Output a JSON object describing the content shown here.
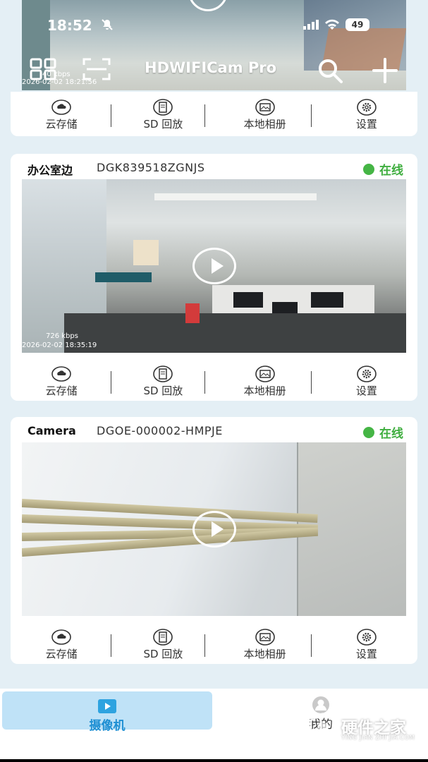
{
  "status_bar": {
    "time": "18:52",
    "battery": "49"
  },
  "header": {
    "title": "HDWIFICam Pro",
    "kbps": "40 kbps",
    "timestamp": "2026-02-02 18:21:56"
  },
  "top_card": {
    "actions": [
      {
        "label": "云存储",
        "icon": "cloud-icon"
      },
      {
        "label": "SD 回放",
        "icon": "sd-card-icon"
      },
      {
        "label": "本地相册",
        "icon": "photo-icon"
      },
      {
        "label": "设置",
        "icon": "gear-icon"
      }
    ]
  },
  "cameras": [
    {
      "name": "办公室边",
      "uid": "DGK839518ZGNJS",
      "status": "在线",
      "kbps": "726 kbps",
      "timestamp": "2026-02-02 18:35:19",
      "actions": [
        {
          "label": "云存储"
        },
        {
          "label": "SD 回放"
        },
        {
          "label": "本地相册"
        },
        {
          "label": "设置"
        }
      ]
    },
    {
      "name": "Camera",
      "uid": "DGOE-000002-HMPJE",
      "status": "在线",
      "actions": [
        {
          "label": "云存储"
        },
        {
          "label": "SD 回放"
        },
        {
          "label": "本地相册"
        },
        {
          "label": "设置"
        }
      ]
    }
  ],
  "bottom_nav": {
    "tabs": [
      {
        "label": "摄像机",
        "active": true
      },
      {
        "label": "我的",
        "active": false
      }
    ]
  },
  "watermark": {
    "text": "硬件之家",
    "sub": "YING JIAN ZHI JIA.COM"
  },
  "colors": {
    "accent": "#1e8fd3",
    "online": "#45b545",
    "background": "#e4eff5"
  }
}
